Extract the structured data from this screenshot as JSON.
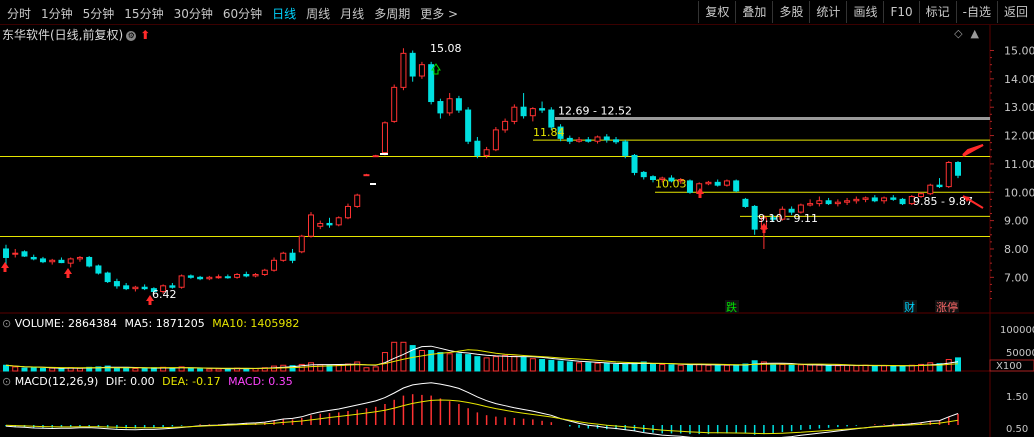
{
  "toolbar": {
    "left_tabs": [
      "分时",
      "1分钟",
      "5分钟",
      "15分钟",
      "30分钟",
      "60分钟",
      "日线",
      "周线",
      "月线",
      "多周期",
      "更多 >"
    ],
    "active_tab": "日线",
    "right_tabs": [
      "复权",
      "叠加",
      "多股",
      "统计",
      "画线",
      "F10",
      "标记",
      "-自选",
      "返回"
    ]
  },
  "title": {
    "stock_name": "东华软件(日线,前复权)",
    "settings_icon": "settings-circle-icon",
    "arrow_icon": "up-arrow-icon"
  },
  "corner_buttons": [
    "◇",
    "▲"
  ],
  "price_axis": {
    "labels": [
      "15.00",
      "14.00",
      "13.00",
      "12.00",
      "11.00",
      "10.00",
      "9.00",
      "8.00",
      "7.00"
    ]
  },
  "annotations": {
    "high": "15.08",
    "low": "6.42",
    "level_1": "12.69 - 12.52",
    "level_2": "11.84",
    "level_3": "10.03",
    "level_4": "9.85 - 9.87",
    "level_5": "9.10 - 9.11",
    "badge_fall": "跌",
    "badge_fin": "财",
    "badge_limit": "涨停"
  },
  "volume": {
    "label": "VOLUME: 2864384",
    "ma5": "MA5: 1871205",
    "ma10": "MA10: 1405982",
    "axis_labels": [
      "100000",
      "50000",
      "X100"
    ]
  },
  "macd": {
    "label": "MACD(12,26,9)",
    "dif": "DIF: 0.00",
    "dea": "DEA: -0.17",
    "macd": "MACD: 0.35",
    "axis_labels": [
      "1.50",
      "0.50"
    ]
  },
  "colors": {
    "up": "#ff3232",
    "down": "#00e0e0",
    "horizontal_line": "#e6e600",
    "grey_line": "#9a9a9a",
    "dea_line": "#e6e600",
    "dif_line": "#ffffff",
    "macd_text": "#ff44ff",
    "active_tab": "#00d5ff"
  },
  "chart_data": {
    "type": "candlestick",
    "ylim": [
      6.2,
      15.3
    ],
    "horizontal_lines": [
      11.26,
      10.0,
      9.15,
      8.44
    ],
    "grey_line": 12.6,
    "candles": [
      [
        8.0,
        8.15,
        7.4,
        7.7
      ],
      [
        7.85,
        8.0,
        7.7,
        7.85
      ],
      [
        7.9,
        7.95,
        7.72,
        7.75
      ],
      [
        7.7,
        7.8,
        7.6,
        7.65
      ],
      [
        7.65,
        7.72,
        7.5,
        7.55
      ],
      [
        7.55,
        7.65,
        7.45,
        7.6
      ],
      [
        7.6,
        7.7,
        7.5,
        7.52
      ],
      [
        7.5,
        7.7,
        7.35,
        7.65
      ],
      [
        7.65,
        7.75,
        7.55,
        7.7
      ],
      [
        7.7,
        7.75,
        7.35,
        7.4
      ],
      [
        7.4,
        7.45,
        7.1,
        7.15
      ],
      [
        7.15,
        7.2,
        6.8,
        6.85
      ],
      [
        6.85,
        6.95,
        6.6,
        6.7
      ],
      [
        6.7,
        6.8,
        6.55,
        6.6
      ],
      [
        6.6,
        6.7,
        6.5,
        6.65
      ],
      [
        6.65,
        6.75,
        6.55,
        6.6
      ],
      [
        6.6,
        6.65,
        6.45,
        6.5
      ],
      [
        6.5,
        6.75,
        6.42,
        6.7
      ],
      [
        6.7,
        6.8,
        6.6,
        6.65
      ],
      [
        6.65,
        7.1,
        6.6,
        7.05
      ],
      [
        7.05,
        7.1,
        6.95,
        7.0
      ],
      [
        7.0,
        7.05,
        6.9,
        6.95
      ],
      [
        6.95,
        7.05,
        6.9,
        7.0
      ],
      [
        7.0,
        7.1,
        6.95,
        7.02
      ],
      [
        7.02,
        7.1,
        6.95,
        7.0
      ],
      [
        7.0,
        7.15,
        6.95,
        7.1
      ],
      [
        7.1,
        7.2,
        7.0,
        7.05
      ],
      [
        7.05,
        7.15,
        7.0,
        7.1
      ],
      [
        7.1,
        7.3,
        7.05,
        7.25
      ],
      [
        7.25,
        7.7,
        7.2,
        7.6
      ],
      [
        7.6,
        7.9,
        7.55,
        7.85
      ],
      [
        7.85,
        8.0,
        7.5,
        7.6
      ],
      [
        7.9,
        8.5,
        7.85,
        8.45
      ],
      [
        8.45,
        9.3,
        8.4,
        9.2
      ],
      [
        8.8,
        9.0,
        8.7,
        8.9
      ],
      [
        8.9,
        9.1,
        8.75,
        8.85
      ],
      [
        8.85,
        9.15,
        8.8,
        9.1
      ],
      [
        9.1,
        9.6,
        9.05,
        9.5
      ],
      [
        9.5,
        9.95,
        9.45,
        9.9
      ],
      [
        10.62,
        10.65,
        10.6,
        10.62
      ],
      [
        11.29,
        11.32,
        11.25,
        11.29
      ],
      [
        11.4,
        12.5,
        11.3,
        12.45
      ],
      [
        12.5,
        13.8,
        12.45,
        13.7
      ],
      [
        13.7,
        15.08,
        13.6,
        14.9
      ],
      [
        14.9,
        15.0,
        13.9,
        14.1
      ],
      [
        14.1,
        14.6,
        14.0,
        14.5
      ],
      [
        14.5,
        14.6,
        13.1,
        13.2
      ],
      [
        13.2,
        13.3,
        12.6,
        12.8
      ],
      [
        12.8,
        13.5,
        12.7,
        13.3
      ],
      [
        13.3,
        13.4,
        12.8,
        12.9
      ],
      [
        12.9,
        13.0,
        11.7,
        11.8
      ],
      [
        11.8,
        11.95,
        11.2,
        11.3
      ],
      [
        11.3,
        11.6,
        11.2,
        11.5
      ],
      [
        11.5,
        12.3,
        11.45,
        12.2
      ],
      [
        12.2,
        12.6,
        12.1,
        12.5
      ],
      [
        12.5,
        13.1,
        12.4,
        13.0
      ],
      [
        13.0,
        13.5,
        12.6,
        12.7
      ],
      [
        12.7,
        13.0,
        12.5,
        12.95
      ],
      [
        12.95,
        13.2,
        12.8,
        12.9
      ],
      [
        12.9,
        13.0,
        12.2,
        12.3
      ],
      [
        12.3,
        12.4,
        11.8,
        11.9
      ],
      [
        11.9,
        12.0,
        11.7,
        11.8
      ],
      [
        11.8,
        11.95,
        11.75,
        11.85
      ],
      [
        11.85,
        11.95,
        11.75,
        11.8
      ],
      [
        11.8,
        12.0,
        11.72,
        11.95
      ],
      [
        11.95,
        12.05,
        11.75,
        11.85
      ],
      [
        11.85,
        11.95,
        11.7,
        11.78
      ],
      [
        11.78,
        11.85,
        11.2,
        11.3
      ],
      [
        11.3,
        11.35,
        10.6,
        10.7
      ],
      [
        10.7,
        10.75,
        10.45,
        10.55
      ],
      [
        10.55,
        10.6,
        10.35,
        10.45
      ],
      [
        10.45,
        10.55,
        10.35,
        10.5
      ],
      [
        10.5,
        10.6,
        10.35,
        10.4
      ],
      [
        10.4,
        10.5,
        10.3,
        10.45
      ],
      [
        10.4,
        10.45,
        9.95,
        10.0
      ],
      [
        10.0,
        10.35,
        9.98,
        10.3
      ],
      [
        10.3,
        10.4,
        10.25,
        10.35
      ],
      [
        10.35,
        10.45,
        10.2,
        10.25
      ],
      [
        10.25,
        10.45,
        10.2,
        10.4
      ],
      [
        10.4,
        10.45,
        10.0,
        10.05
      ],
      [
        9.75,
        9.8,
        9.45,
        9.5
      ],
      [
        9.5,
        9.55,
        8.5,
        8.7
      ],
      [
        8.7,
        9.2,
        8.0,
        9.1
      ],
      [
        9.1,
        9.2,
        8.95,
        9.05
      ],
      [
        9.05,
        9.5,
        9.0,
        9.4
      ],
      [
        9.4,
        9.5,
        9.2,
        9.3
      ],
      [
        9.3,
        9.6,
        9.25,
        9.55
      ],
      [
        9.55,
        9.75,
        9.5,
        9.6
      ],
      [
        9.6,
        9.85,
        9.5,
        9.7
      ],
      [
        9.7,
        9.8,
        9.55,
        9.6
      ],
      [
        9.6,
        9.75,
        9.5,
        9.65
      ],
      [
        9.65,
        9.8,
        9.55,
        9.7
      ],
      [
        9.7,
        9.85,
        9.6,
        9.75
      ],
      [
        9.75,
        9.85,
        9.65,
        9.8
      ],
      [
        9.8,
        9.9,
        9.65,
        9.7
      ],
      [
        9.7,
        9.85,
        9.6,
        9.8
      ],
      [
        9.8,
        9.9,
        9.7,
        9.75
      ],
      [
        9.75,
        9.8,
        9.55,
        9.6
      ],
      [
        9.6,
        9.9,
        9.55,
        9.85
      ],
      [
        9.85,
        10.0,
        9.8,
        9.95
      ],
      [
        9.95,
        10.3,
        9.9,
        10.25
      ],
      [
        10.25,
        10.5,
        10.15,
        10.2
      ],
      [
        10.2,
        11.1,
        10.15,
        11.05
      ],
      [
        11.05,
        11.1,
        10.5,
        10.6
      ]
    ],
    "volumes": [
      0.14,
      0.1,
      0.07,
      0.08,
      0.06,
      0.07,
      0.06,
      0.08,
      0.07,
      0.09,
      0.1,
      0.12,
      0.08,
      0.07,
      0.06,
      0.06,
      0.08,
      0.09,
      0.07,
      0.1,
      0.06,
      0.06,
      0.05,
      0.05,
      0.06,
      0.07,
      0.06,
      0.06,
      0.08,
      0.12,
      0.14,
      0.13,
      0.16,
      0.2,
      0.15,
      0.14,
      0.14,
      0.17,
      0.22,
      0.08,
      0.1,
      0.45,
      0.7,
      0.7,
      0.62,
      0.5,
      0.5,
      0.45,
      0.42,
      0.42,
      0.4,
      0.35,
      0.32,
      0.35,
      0.38,
      0.36,
      0.34,
      0.3,
      0.28,
      0.26,
      0.24,
      0.22,
      0.2,
      0.2,
      0.19,
      0.18,
      0.16,
      0.17,
      0.2,
      0.22,
      0.17,
      0.16,
      0.15,
      0.14,
      0.16,
      0.17,
      0.14,
      0.13,
      0.14,
      0.15,
      0.17,
      0.25,
      0.22,
      0.15,
      0.16,
      0.14,
      0.15,
      0.15,
      0.14,
      0.13,
      0.13,
      0.14,
      0.13,
      0.14,
      0.12,
      0.13,
      0.13,
      0.12,
      0.14,
      0.16,
      0.2,
      0.18,
      0.28,
      0.32
    ],
    "macd_bars": [
      -0.02,
      -0.03,
      -0.03,
      -0.04,
      -0.04,
      -0.04,
      -0.03,
      -0.03,
      -0.02,
      -0.02,
      -0.03,
      -0.04,
      -0.05,
      -0.05,
      -0.05,
      -0.04,
      -0.04,
      -0.03,
      -0.02,
      -0.01,
      0.0,
      0.01,
      0.01,
      0.01,
      0.02,
      0.02,
      0.03,
      0.03,
      0.04,
      0.06,
      0.08,
      0.08,
      0.1,
      0.14,
      0.16,
      0.17,
      0.18,
      0.2,
      0.22,
      0.24,
      0.26,
      0.3,
      0.36,
      0.42,
      0.44,
      0.43,
      0.42,
      0.38,
      0.34,
      0.3,
      0.24,
      0.18,
      0.14,
      0.12,
      0.11,
      0.1,
      0.09,
      0.08,
      0.06,
      0.04,
      0.0,
      -0.02,
      -0.04,
      -0.05,
      -0.05,
      -0.06,
      -0.06,
      -0.07,
      -0.08,
      -0.1,
      -0.11,
      -0.12,
      -0.12,
      -0.12,
      -0.13,
      -0.13,
      -0.13,
      -0.12,
      -0.12,
      -0.12,
      -0.12,
      -0.14,
      -0.13,
      -0.12,
      -0.1,
      -0.09,
      -0.07,
      -0.06,
      -0.05,
      -0.04,
      -0.03,
      -0.02,
      -0.01,
      0.0,
      0.01,
      0.01,
      0.02,
      0.02,
      0.03,
      0.04,
      0.06,
      0.06,
      0.12,
      0.16
    ]
  }
}
